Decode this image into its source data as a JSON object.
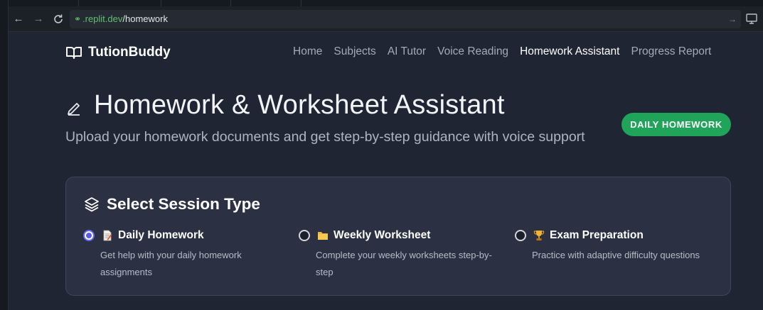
{
  "browser": {
    "url_host": ".replit.dev",
    "url_path": "/homework"
  },
  "brand": {
    "name": "TutionBuddy"
  },
  "nav": {
    "items": [
      {
        "label": "Home"
      },
      {
        "label": "Subjects"
      },
      {
        "label": "AI Tutor"
      },
      {
        "label": "Voice Reading"
      },
      {
        "label": "Homework Assistant",
        "active": true
      },
      {
        "label": "Progress Report"
      }
    ]
  },
  "header": {
    "title": "Homework & Worksheet Assistant",
    "subtitle": "Upload your homework documents and get step-by-step guidance with voice support",
    "badge": "DAILY HOMEWORK"
  },
  "session": {
    "title": "Select Session Type",
    "options": [
      {
        "icon": "memo-emoji",
        "label": "Daily Homework",
        "description": "Get help with your daily homework assignments",
        "selected": true
      },
      {
        "icon": "folder-emoji",
        "label": "Weekly Worksheet",
        "description": "Complete your weekly worksheets step-by-step",
        "selected": false
      },
      {
        "icon": "trophy-emoji",
        "label": "Exam Preparation",
        "description": "Practice with adaptive difficulty questions",
        "selected": false
      }
    ]
  },
  "colors": {
    "page_bg": "#1f2533",
    "card_bg": "#2b3142",
    "badge_green": "#1fa45a",
    "radio_accent": "#6366f1",
    "url_host_green": "#5fbf6f"
  }
}
